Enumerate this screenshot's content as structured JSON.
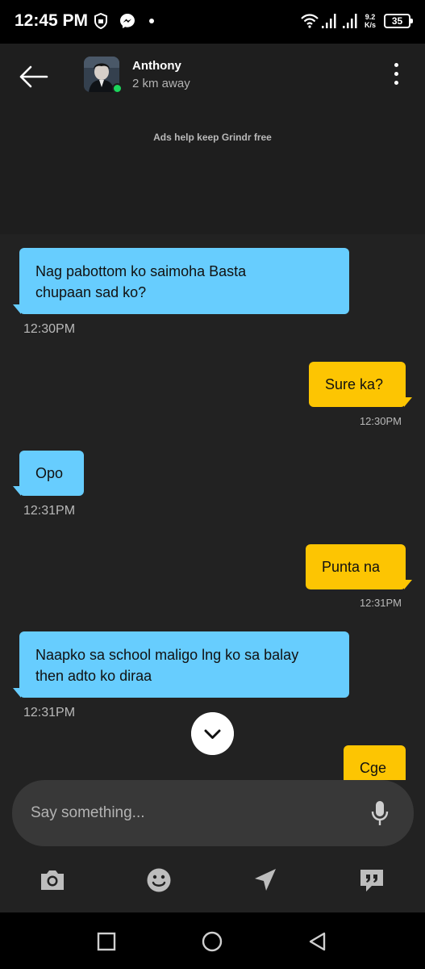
{
  "status_bar": {
    "time": "12:45 PM",
    "net_speed_value": "9.2",
    "net_speed_unit": "K/s",
    "battery": "35",
    "icons": [
      "shield-icon",
      "messenger-icon",
      "dot-icon",
      "wifi-icon",
      "signal-icon",
      "signal-icon"
    ]
  },
  "header": {
    "contact_name": "Anthony",
    "contact_distance": "2 km away",
    "online": true,
    "ads_text": "Ads help keep Grindr free"
  },
  "messages": [
    {
      "direction": "in",
      "lines": [
        "Nag pabottom ko saimoha Basta",
        "chupaan sad ko?"
      ],
      "time": "12:30PM"
    },
    {
      "direction": "out",
      "lines": [
        "Sure ka?"
      ],
      "time": "12:30PM"
    },
    {
      "direction": "in",
      "lines": [
        "Opo"
      ],
      "time": "12:31PM"
    },
    {
      "direction": "out",
      "lines": [
        "Punta na"
      ],
      "time": "12:31PM"
    },
    {
      "direction": "in",
      "lines": [
        "Naapko sa school maligo lng ko sa balay",
        "then adto ko diraa"
      ],
      "time": "12:31PM"
    },
    {
      "direction": "out",
      "lines": [
        "Cge"
      ],
      "time": ""
    }
  ],
  "composer": {
    "placeholder": "Say something...",
    "tools": [
      "camera-icon",
      "smiley-icon",
      "location-arrow-icon",
      "saved-phrases-icon"
    ]
  },
  "colors": {
    "incoming": "#67cdfe",
    "outgoing": "#fdc502",
    "background": "#222222",
    "online": "#1bd65c"
  }
}
